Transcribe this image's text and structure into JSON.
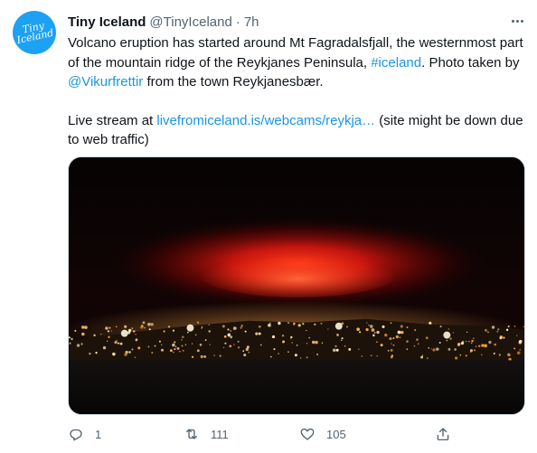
{
  "author": {
    "display_name": "Tiny Iceland",
    "handle": "@TinyIceland",
    "separator": "·",
    "time": "7h",
    "avatar_text": "Tiny Iceland"
  },
  "tweet": {
    "line1_a": "Volcano eruption has started around Mt Fagradalsfjall, the westernmost part of the mountain ridge of the Reykjanes Peninsula, ",
    "hashtag": "#iceland",
    "line1_b": ". Photo taken by ",
    "mention": "@Vikurfrettir",
    "line1_c": " from the town Reykjanesbær.",
    "line2_a": "Live stream at ",
    "url": "livefromiceland.is/webcams/reykja…",
    "line2_b": " (site might be down due to web traffic)"
  },
  "actions": {
    "reply_count": "1",
    "retweet_count": "111",
    "like_count": "105"
  },
  "icons": {
    "more": "more-horizontal-icon",
    "reply": "reply-icon",
    "retweet": "retweet-icon",
    "like": "heart-icon",
    "share": "share-icon"
  },
  "colors": {
    "link": "#1b95e0",
    "secondary_text": "#536471",
    "avatar_bg": "#1da1f2"
  }
}
